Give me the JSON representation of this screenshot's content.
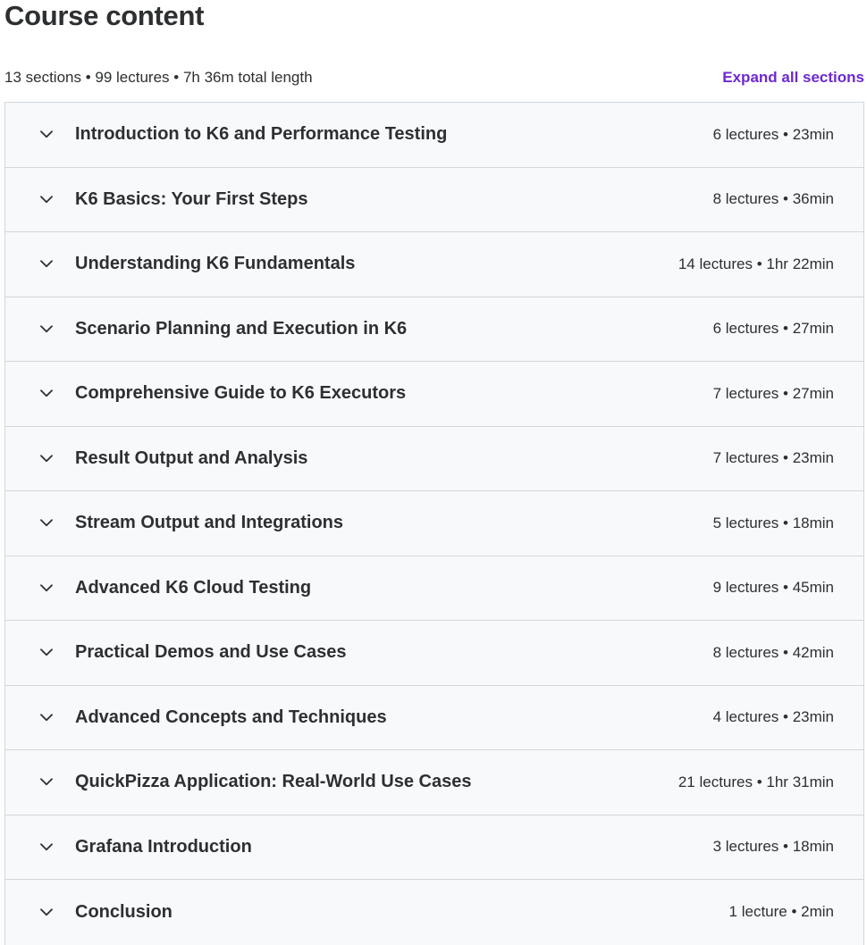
{
  "header": {
    "title": "Course content",
    "summary": "13 sections • 99 lectures • 7h 36m total length",
    "expand_all_label": "Expand all sections"
  },
  "icons": {
    "section_toggle": "chevron-down-icon"
  },
  "colors": {
    "accent": "#6d28d2",
    "section_bg": "#f7f9fa",
    "border": "#d1d7dc",
    "text": "#2d2f31"
  },
  "sections": [
    {
      "title": "Introduction to K6 and Performance Testing",
      "meta": "6 lectures • 23min"
    },
    {
      "title": "K6 Basics: Your First Steps",
      "meta": "8 lectures • 36min"
    },
    {
      "title": "Understanding K6 Fundamentals",
      "meta": "14 lectures • 1hr 22min"
    },
    {
      "title": "Scenario Planning and Execution in K6",
      "meta": "6 lectures • 27min"
    },
    {
      "title": "Comprehensive Guide to K6 Executors",
      "meta": "7 lectures • 27min"
    },
    {
      "title": "Result Output and Analysis",
      "meta": "7 lectures • 23min"
    },
    {
      "title": "Stream Output and Integrations",
      "meta": "5 lectures • 18min"
    },
    {
      "title": "Advanced K6 Cloud Testing",
      "meta": "9 lectures • 45min"
    },
    {
      "title": "Practical Demos and Use Cases",
      "meta": "8 lectures • 42min"
    },
    {
      "title": "Advanced Concepts and Techniques",
      "meta": "4 lectures • 23min"
    },
    {
      "title": "QuickPizza Application: Real-World Use Cases",
      "meta": "21 lectures • 1hr 31min"
    },
    {
      "title": "Grafana Introduction",
      "meta": "3 lectures • 18min"
    },
    {
      "title": "Conclusion",
      "meta": "1 lecture • 2min"
    }
  ]
}
